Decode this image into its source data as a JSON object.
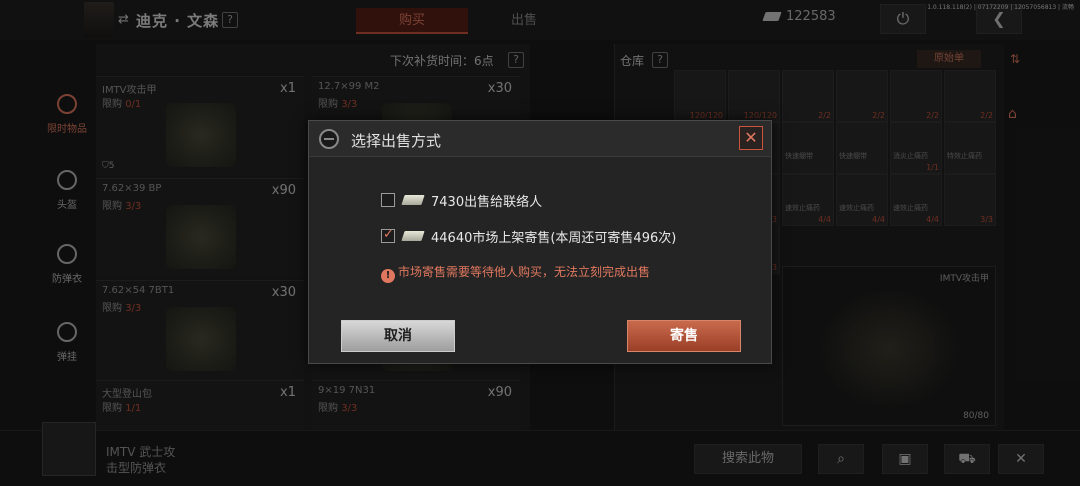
{
  "header": {
    "trader_name": "迪克 · 文森",
    "help": "?",
    "tabs": [
      {
        "label": "购买",
        "active": true
      },
      {
        "label": "出售",
        "active": false
      }
    ],
    "money": "122583",
    "version": "1.0.118.118(2) | 07172209 | 12057056813 | 流畅"
  },
  "left_nav": [
    {
      "label": "限时物品",
      "icon": "clock-icon",
      "active": true
    },
    {
      "label": "头盔",
      "icon": "helmet-icon"
    },
    {
      "label": "防弹衣",
      "icon": "vest-icon"
    },
    {
      "label": "弹挂",
      "icon": "rig-icon"
    }
  ],
  "shop": {
    "restock_label": "下次补货时间：6点",
    "items": [
      {
        "name": "IMTV攻击甲",
        "limit_label": "限购",
        "limit": "0/1",
        "qty": "x1",
        "tier": "5"
      },
      {
        "name": "12.7×99 M2",
        "limit_label": "限购",
        "limit": "3/3",
        "qty": "x30"
      },
      {
        "name": "7.62×39 BP",
        "limit_label": "限购",
        "limit": "3/3",
        "qty": "x90"
      },
      {
        "name": "",
        "limit_label": "",
        "limit": "",
        "qty": ""
      },
      {
        "name": "7.62×54 7BT1",
        "limit_label": "限购",
        "limit": "3/3",
        "qty": "x30"
      },
      {
        "name": "",
        "limit_label": "",
        "limit": "",
        "qty": ""
      },
      {
        "name": "大型登山包",
        "limit_label": "限购",
        "limit": "1/1",
        "qty": "x1"
      },
      {
        "name": "9×19 7N31",
        "limit_label": "限购",
        "limit": "3/3",
        "qty": "x90"
      }
    ]
  },
  "warehouse": {
    "title": "仓库",
    "sort_label": "原始单",
    "cells": [
      {
        "label": "",
        "count": "120/120"
      },
      {
        "label": "",
        "count": "120/120"
      },
      {
        "label": "",
        "count": "2/2"
      },
      {
        "label": "",
        "count": "2/2"
      },
      {
        "label": "",
        "count": "2/2"
      },
      {
        "label": "",
        "count": "2/2"
      },
      {
        "label": "野战绷带",
        "count": ""
      },
      {
        "label": "快速绷带",
        "count": ""
      },
      {
        "label": "快速绷带",
        "count": ""
      },
      {
        "label": "快速绷带",
        "count": ""
      },
      {
        "label": "快速绷带",
        "count": ""
      },
      {
        "label": "消炎止痛药",
        "count": "1/1"
      },
      {
        "label": "特效止痛药",
        "count": ""
      },
      {
        "label": "特效止痛药",
        "count": ""
      },
      {
        "label": "特效止痛药",
        "count": ""
      },
      {
        "label": "",
        "count": "3/3"
      },
      {
        "label": "速效止痛药",
        "count": "4/4"
      },
      {
        "label": "速效止痛药",
        "count": "4/4"
      },
      {
        "label": "速效止痛药",
        "count": "4/4"
      },
      {
        "label": "",
        "count": "3/3"
      },
      {
        "label": "",
        "count": "3/3"
      },
      {
        "label": "",
        "count": "3/3"
      },
      {
        "label": "",
        "count": "3/3"
      }
    ],
    "detail_name": "IMTV攻击甲",
    "detail_durability": "80/80"
  },
  "bottom": {
    "selected_name_line1": "IMTV 武士攻",
    "selected_name_line2": "击型防弹衣",
    "search_label": "搜索此物"
  },
  "dialog": {
    "title": "选择出售方式",
    "close": "✕",
    "options": [
      {
        "checked": false,
        "text": "7430出售给联络人"
      },
      {
        "checked": true,
        "text": "44640市场上架寄售(本周还可寄售496次)"
      }
    ],
    "warning_icon": "!",
    "warning": "市场寄售需要等待他人购买，无法立刻完成出售",
    "cancel_label": "取消",
    "confirm_label": "寄售"
  }
}
